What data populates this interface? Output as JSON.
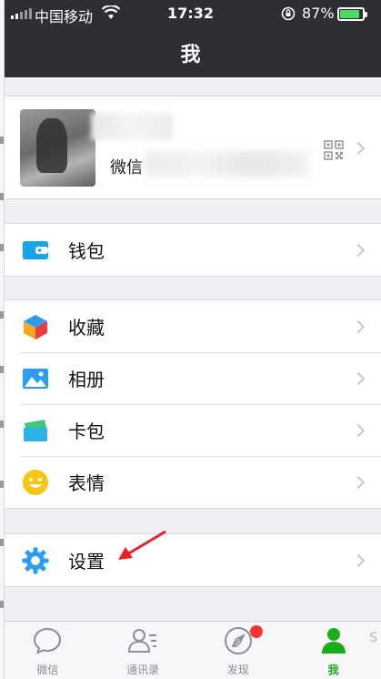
{
  "status_bar": {
    "carrier": "中国移动",
    "time": "17:32",
    "battery_percent": "87%",
    "battery_level": 0.87
  },
  "header": {
    "title": "我"
  },
  "profile": {
    "wechat_label": "微信"
  },
  "menu": {
    "wallet": "钱包",
    "favorites": "收藏",
    "album": "相册",
    "cards": "卡包",
    "stickers": "表情",
    "settings": "设置"
  },
  "tabs": [
    {
      "label": "微信",
      "icon": "chat-icon"
    },
    {
      "label": "通讯录",
      "icon": "contacts-icon"
    },
    {
      "label": "发现",
      "icon": "compass-icon",
      "badge": true
    },
    {
      "label": "我",
      "icon": "me-icon",
      "active": true
    }
  ],
  "watermark": "S",
  "colors": {
    "accent_green": "#1aad19",
    "header_bg": "#2e2e33",
    "badge_red": "#f43530",
    "arrow_red": "#e8202a"
  }
}
